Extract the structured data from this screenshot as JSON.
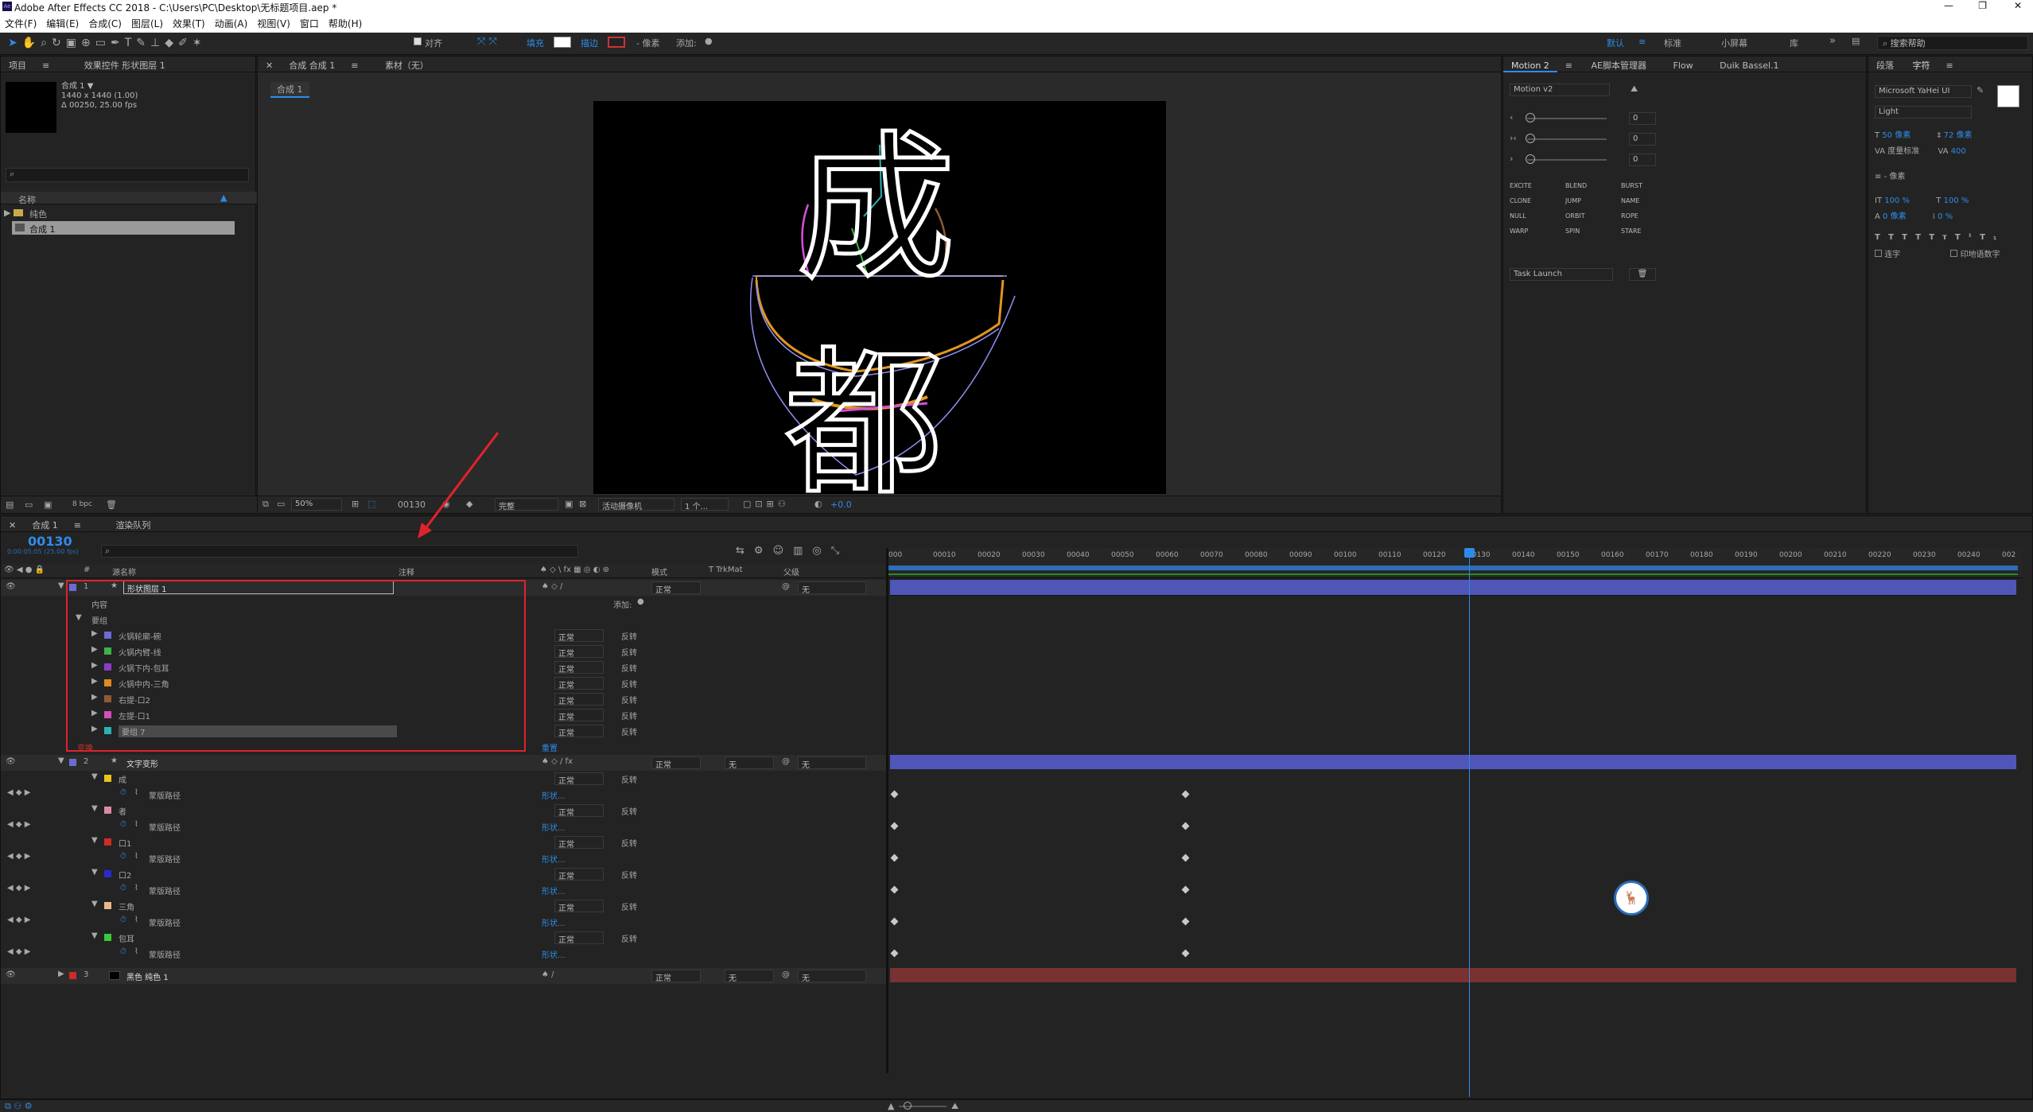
{
  "app": {
    "title": "Adobe After Effects CC 2018 - C:\\Users\\PC\\Desktop\\无标题项目.aep *",
    "menu": [
      "文件(F)",
      "编辑(E)",
      "合成(C)",
      "图层(L)",
      "效果(T)",
      "动画(A)",
      "视图(V)",
      "窗口",
      "帮助(H)"
    ]
  },
  "toolbar": {
    "align": "对齐",
    "fill": "填充",
    "stroke": "描边",
    "pixels": "- 像素",
    "add": "添加:",
    "workspaces": [
      "默认",
      "标准",
      "小屏幕",
      "库"
    ],
    "search_placeholder": "搜索帮助"
  },
  "project": {
    "tabs": [
      "项目",
      "效果控件 形状图层 1"
    ],
    "comp_name": "合成 1 ▼",
    "comp_size": "1440 x 1440 (1.00)",
    "comp_dur": "Δ 00250, 25.00 fps",
    "col_name": "名称",
    "items": [
      "纯色",
      "合成 1"
    ],
    "bpc": "8 bpc"
  },
  "viewer": {
    "tabs": [
      "合成 合成 1",
      "素材（无）"
    ],
    "crumb": "合成 1",
    "zoom": "50%",
    "frame": "00130",
    "quality": "完整",
    "camera": "活动摄像机",
    "views": "1 个...",
    "exposure": "+0.0",
    "text_top": "成",
    "text_bottom": "都"
  },
  "motion": {
    "tabs": [
      "Motion 2",
      "AE脚本管理器",
      "Flow",
      "Duik Bassel.1"
    ],
    "version": "Motion v2",
    "sliders": [
      "0",
      "0",
      "0"
    ],
    "buttons": [
      "EXCITE",
      "BLEND",
      "BURST",
      "CLONE",
      "JUMP",
      "NAME",
      "NULL",
      "ORBIT",
      "ROPE",
      "WARP",
      "SPIN",
      "STARE"
    ],
    "task": "Task Launch"
  },
  "char": {
    "tabs": [
      "段落",
      "字符"
    ],
    "font": "Microsoft YaHei UI",
    "style": "Light",
    "size": "50 像素",
    "leading": "72 像素",
    "kern": "度量标准",
    "track": "400",
    "stroke_w": "- 像素",
    "vscale": "100 %",
    "hscale": "100 %",
    "baseline": "0 像素",
    "tsume": "0 %",
    "styles": [
      "T",
      "T",
      "TT",
      "Tт",
      "T¹",
      "T₁"
    ],
    "ligature": "连字",
    "hindi": "印地语数字"
  },
  "timeline": {
    "tabs": [
      "合成 1",
      "渲染队列"
    ],
    "timecode": "00130",
    "timecode_sub": "0:00:05:05 (25.00 fps)",
    "cols": {
      "name": "源名称",
      "comment": "注释",
      "mode": "模式",
      "trk": "T TrkMat",
      "parent": "父级"
    },
    "ruler": [
      "000",
      "00010",
      "00020",
      "00030",
      "00040",
      "00050",
      "00060",
      "00070",
      "00080",
      "00090",
      "00100",
      "00110",
      "00120",
      "00130",
      "00140",
      "00150",
      "00160",
      "00170",
      "00180",
      "00190",
      "00200",
      "00210",
      "00220",
      "00230",
      "00240",
      "002"
    ],
    "layer1": {
      "num": "1",
      "name": "形状图层 1",
      "mode": "正常",
      "parent": "无",
      "content": "内容",
      "add": "添加:",
      "group": "要组",
      "subs": [
        {
          "name": "火锅轮廓-碗",
          "color": "#6b6bd6"
        },
        {
          "name": "火锅内臂-线",
          "color": "#3db34a"
        },
        {
          "name": "火锅下内-包耳",
          "color": "#8a3cc9"
        },
        {
          "name": "火锅中内-三角",
          "color": "#e08a1a"
        },
        {
          "name": "右提-口2",
          "color": "#8c5a34"
        },
        {
          "name": "左提-口1",
          "color": "#d44fb5"
        },
        {
          "name": "要组 7",
          "color": "#2bb1b1"
        }
      ],
      "blend": "正常",
      "invert": "反转",
      "transform": "变换",
      "reset": "重置"
    },
    "layer2": {
      "num": "2",
      "name": "文字变形",
      "mode": "正常",
      "trk": "无",
      "parent": "无",
      "subs": [
        {
          "name": "成",
          "color": "#e7c51c"
        },
        {
          "name": "者",
          "color": "#d98aa7"
        },
        {
          "name": "口1",
          "color": "#d12a2a"
        },
        {
          "name": "口2",
          "color": "#2a2ad1"
        },
        {
          "name": "三角",
          "color": "#e8b88a"
        },
        {
          "name": "包耳",
          "color": "#3ac93a"
        }
      ],
      "path": "蒙版路径",
      "shape": "形状..."
    },
    "layer3": {
      "num": "3",
      "name": "黑色 纯色 1",
      "mode": "正常",
      "trk": "无",
      "parent": "无"
    }
  }
}
